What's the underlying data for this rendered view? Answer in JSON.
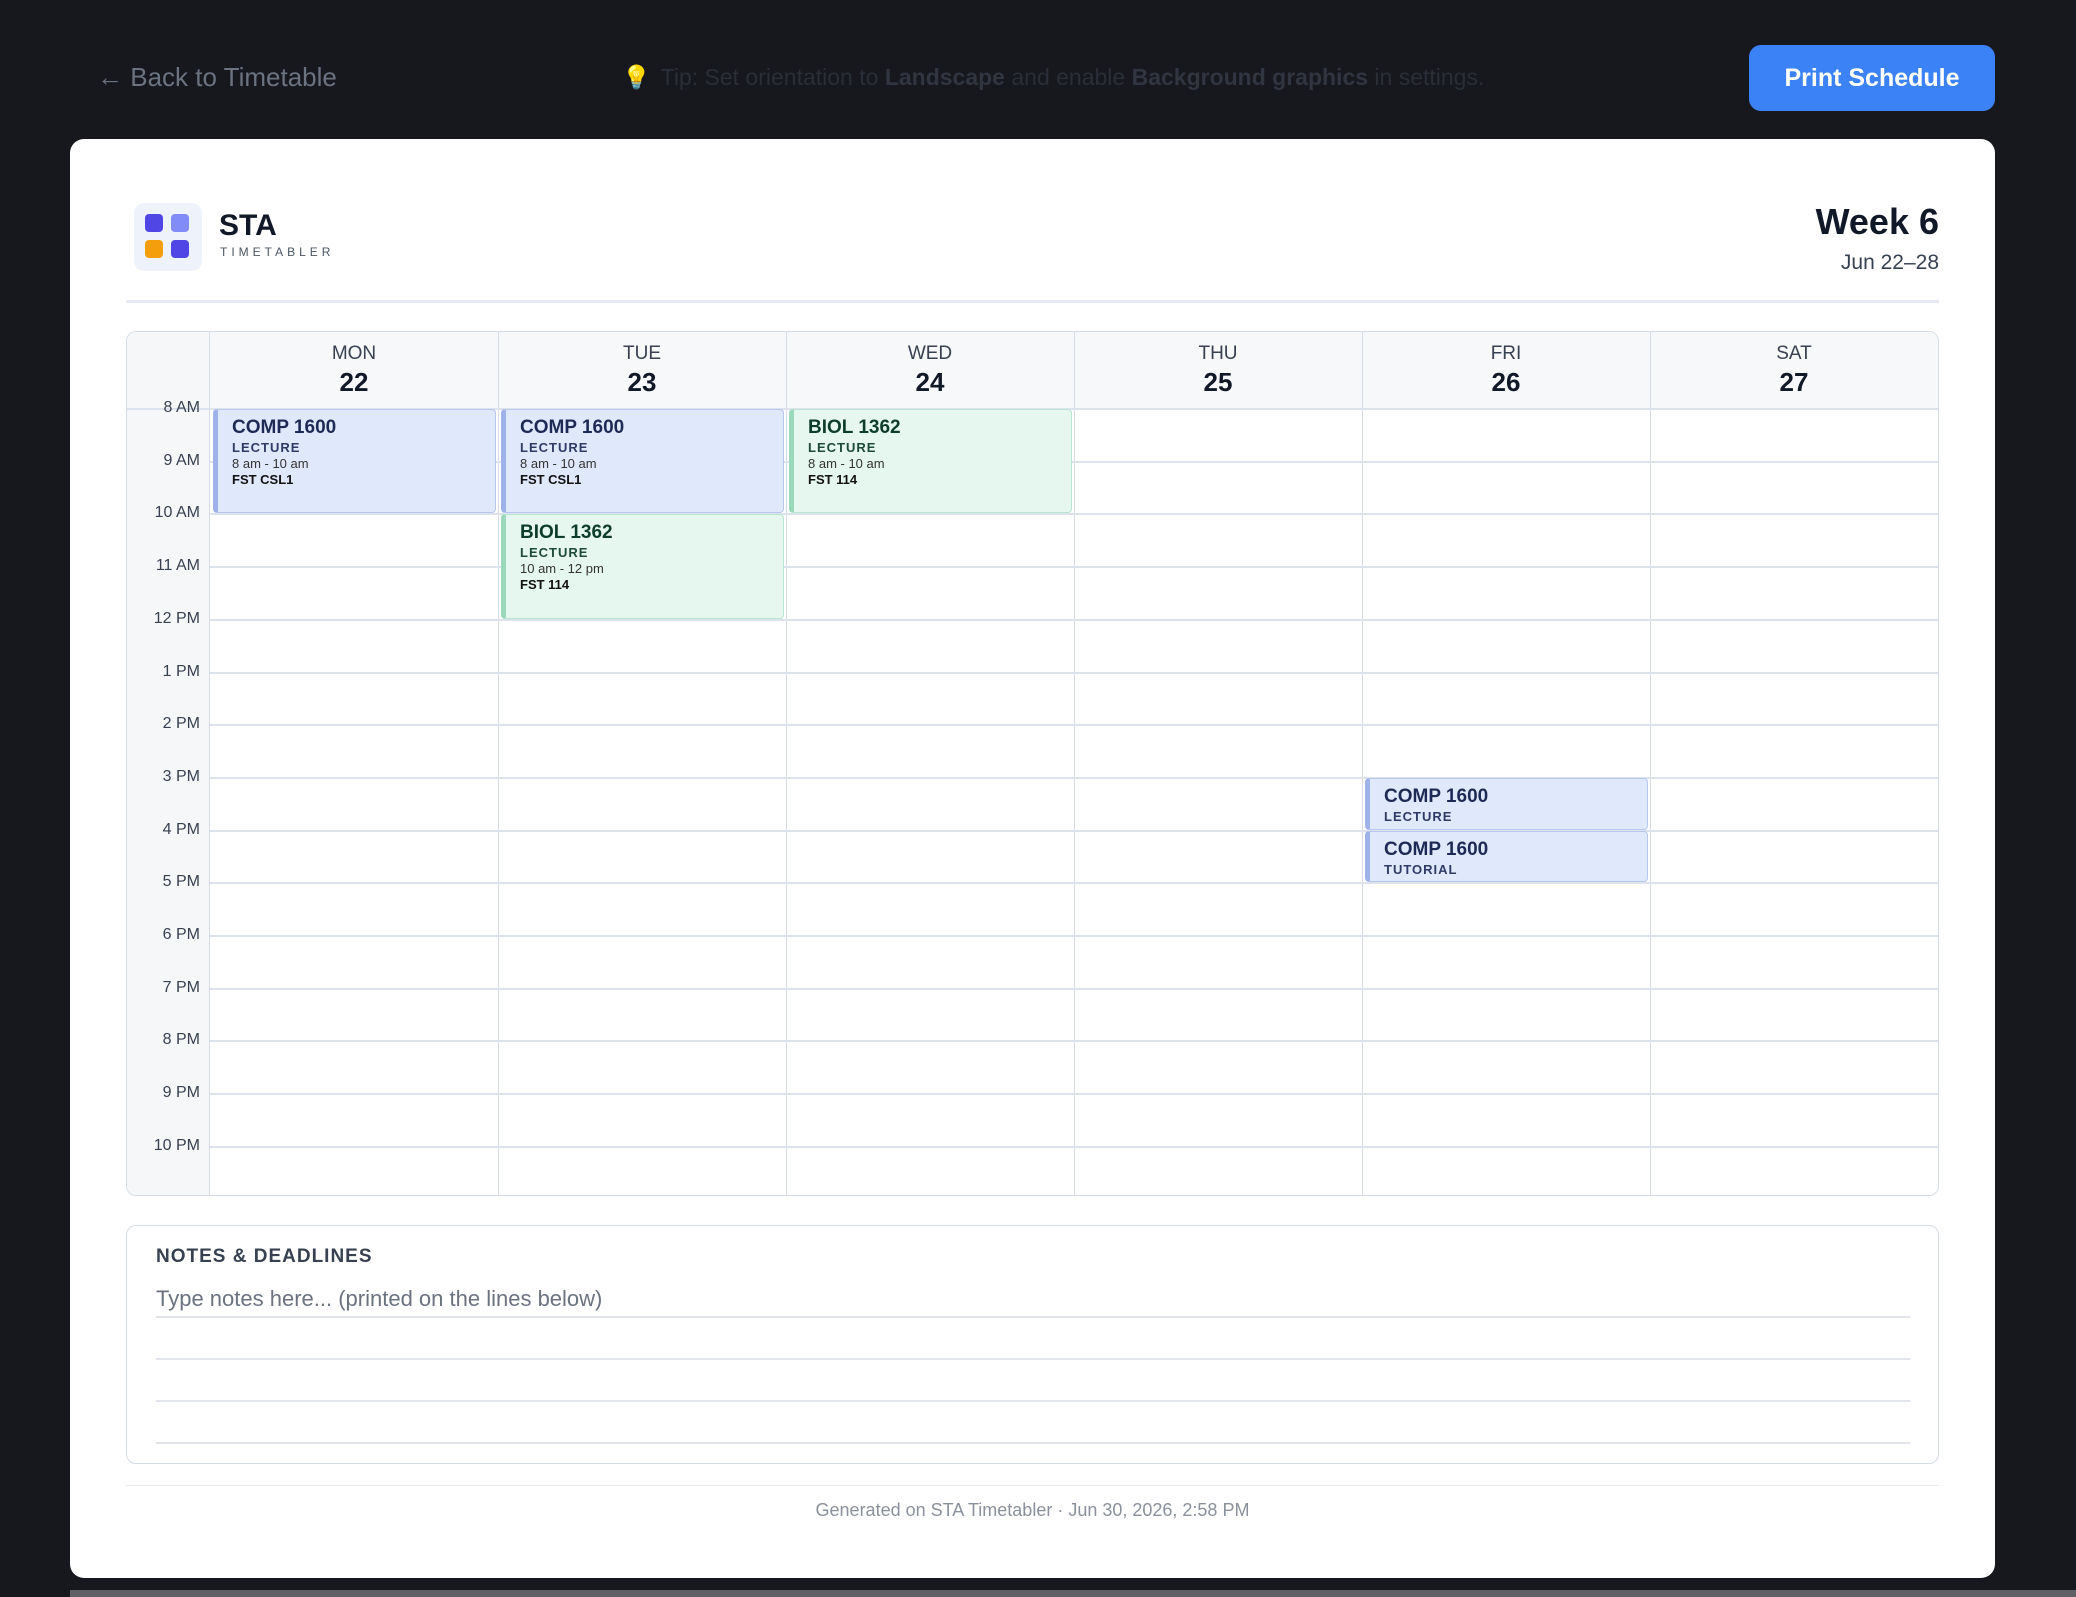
{
  "topbar": {
    "back_label": "← Back to Timetable",
    "tip_prefix": "Tip: Set orientation to ",
    "tip_bold1": "Landscape",
    "tip_mid": " and enable ",
    "tip_bold2": "Background graphics",
    "tip_suffix": " in settings.",
    "tip_icon": "lightbulb-icon",
    "print_label": "Print Schedule",
    "print_color": "#3b82f6"
  },
  "brand": {
    "name": "STA",
    "subtitle": "TIMETABLER",
    "logo_colors": [
      "#4f46e5",
      "#818cf8",
      "#f59e0b",
      "#4f46e5"
    ]
  },
  "week": {
    "title": "Week 6",
    "range": "Jun 22–28"
  },
  "days": [
    {
      "name": "MON",
      "date": "22"
    },
    {
      "name": "TUE",
      "date": "23"
    },
    {
      "name": "WED",
      "date": "24"
    },
    {
      "name": "THU",
      "date": "25"
    },
    {
      "name": "FRI",
      "date": "26"
    },
    {
      "name": "SAT",
      "date": "27"
    }
  ],
  "hours": [
    "8 AM",
    "9 AM",
    "10 AM",
    "11 AM",
    "12 PM",
    "1 PM",
    "2 PM",
    "3 PM",
    "4 PM",
    "5 PM",
    "6 PM",
    "7 PM",
    "8 PM",
    "9 PM",
    "10 PM"
  ],
  "events": [
    {
      "day": 0,
      "start": 8,
      "end": 10,
      "title": "COMP 1600",
      "type": "LECTURE",
      "time": "8 am - 10 am",
      "room": "FST CSL1",
      "color": "blue"
    },
    {
      "day": 1,
      "start": 8,
      "end": 10,
      "title": "COMP 1600",
      "type": "LECTURE",
      "time": "8 am - 10 am",
      "room": "FST CSL1",
      "color": "blue"
    },
    {
      "day": 2,
      "start": 8,
      "end": 10,
      "title": "BIOL 1362",
      "type": "LECTURE",
      "time": "8 am - 10 am",
      "room": "FST 114",
      "color": "green"
    },
    {
      "day": 1,
      "start": 10,
      "end": 12,
      "title": "BIOL 1362",
      "type": "LECTURE",
      "time": "10 am - 12 pm",
      "room": "FST 114",
      "color": "green"
    },
    {
      "day": 4,
      "start": 15,
      "end": 16,
      "title": "COMP 1600",
      "type": "LECTURE",
      "color": "blue"
    },
    {
      "day": 4,
      "start": 16,
      "end": 17,
      "title": "COMP 1600",
      "type": "TUTORIAL",
      "color": "blue"
    }
  ],
  "notes": {
    "title": "NOTES & DEADLINES",
    "placeholder": "Type notes here... (printed on the lines below)"
  },
  "footer": {
    "text": "Generated on STA Timetabler · Jun 30, 2026, 2:58 PM"
  }
}
